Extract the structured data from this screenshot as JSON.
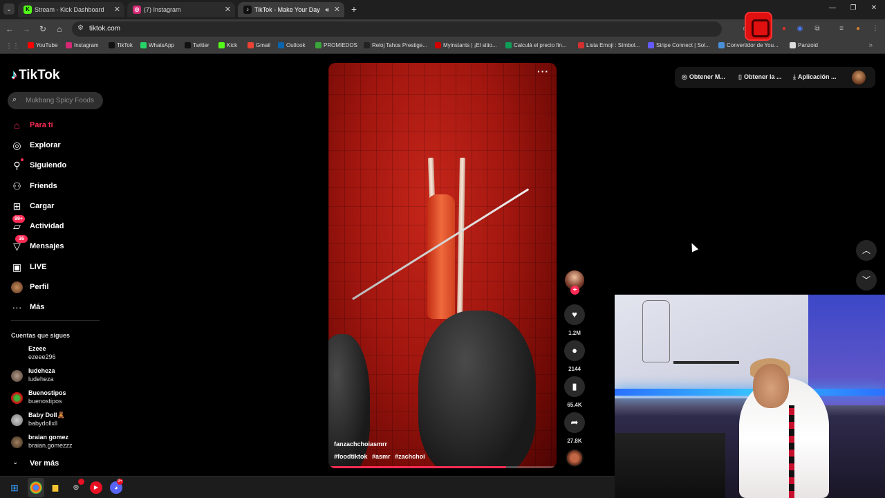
{
  "browser": {
    "tabs": [
      {
        "title": "Stream - Kick Dashboard",
        "active": false,
        "favicon": "kick-icon"
      },
      {
        "title": "(7) Instagram",
        "active": false,
        "favicon": "instagram-icon"
      },
      {
        "title": "TikTok - Make Your Day",
        "active": true,
        "favicon": "tiktok-icon",
        "audio": true
      }
    ],
    "url": "tiktok.com",
    "bookmarks": [
      {
        "label": "YouTube",
        "icon": "youtube-icon",
        "color": "#ff0000"
      },
      {
        "label": "Instagram",
        "icon": "instagram-icon",
        "color": "#d62976"
      },
      {
        "label": "TikTok",
        "icon": "tiktok-icon",
        "color": "#111111"
      },
      {
        "label": "WhatsApp",
        "icon": "whatsapp-icon",
        "color": "#25d366"
      },
      {
        "label": "Twitter",
        "icon": "x-icon",
        "color": "#111111"
      },
      {
        "label": "Kick",
        "icon": "kick-icon",
        "color": "#53fc18"
      },
      {
        "label": "Gmail",
        "icon": "gmail-icon",
        "color": "#ea4335"
      },
      {
        "label": "Outlook",
        "icon": "outlook-icon",
        "color": "#0a64ad"
      },
      {
        "label": "PROMIEDOS",
        "icon": "promiedos-icon",
        "color": "#3aa63a"
      },
      {
        "label": "Reloj Tahos Prestige...",
        "icon": "clock-icon",
        "color": "#222222"
      },
      {
        "label": "Myinstants | ¡El sitio...",
        "icon": "myinstants-icon",
        "color": "#d00000"
      },
      {
        "label": "Calculá el precio fin...",
        "icon": "sheets-icon",
        "color": "#0f9d58"
      },
      {
        "label": "Lista Emoji : Símbol...",
        "icon": "emoji-icon",
        "color": "#d32f2f"
      },
      {
        "label": "Stripe Connect | Sol...",
        "icon": "stripe-icon",
        "color": "#635bff"
      },
      {
        "label": "Convertidor de You...",
        "icon": "cloud-icon",
        "color": "#4a90d9"
      },
      {
        "label": "Panzoid",
        "icon": "panzoid-icon",
        "color": "#dddddd"
      }
    ]
  },
  "tiktok": {
    "logo": "TikTok",
    "search_placeholder": "Mukbang Spicy Foods",
    "nav": [
      {
        "label": "Para ti",
        "icon": "home-icon",
        "active": true
      },
      {
        "label": "Explorar",
        "icon": "compass-icon"
      },
      {
        "label": "Siguiendo",
        "icon": "following-icon",
        "dot": true
      },
      {
        "label": "Friends",
        "icon": "friends-icon"
      },
      {
        "label": "Cargar",
        "icon": "upload-icon"
      },
      {
        "label": "Actividad",
        "icon": "activity-icon",
        "badge": "99+"
      },
      {
        "label": "Mensajes",
        "icon": "messages-icon",
        "badge": "36"
      },
      {
        "label": "LIVE",
        "icon": "live-icon"
      },
      {
        "label": "Perfil",
        "icon": "profile-avatar"
      },
      {
        "label": "Más",
        "icon": "more-icon"
      }
    ],
    "following_title": "Cuentas que sigues",
    "following": [
      {
        "name": "Ezeee",
        "username": "ezeee296"
      },
      {
        "name": "ludeheza",
        "username": "ludeheza"
      },
      {
        "name": "Buenostipos",
        "username": "buenostipos"
      },
      {
        "name": "Baby Doll🧸",
        "username": "babydollxll"
      },
      {
        "name": "braian gomez",
        "username": "braian.gomezzz"
      }
    ],
    "see_more": "Ver más",
    "header": {
      "btn1": "Obtener M...",
      "btn2": "Obtener la ...",
      "btn3": "Aplicación ..."
    },
    "video": {
      "author": "fanzachchoiasmrr",
      "tags": [
        "#foodtiktok",
        "#asmr",
        "#zachchoi"
      ],
      "likes": "1.2M",
      "comments": "2144",
      "saves": "65.4K",
      "shares": "27.8K",
      "progress": 0.78
    }
  },
  "taskbar": {
    "discord_badge": "9+"
  }
}
